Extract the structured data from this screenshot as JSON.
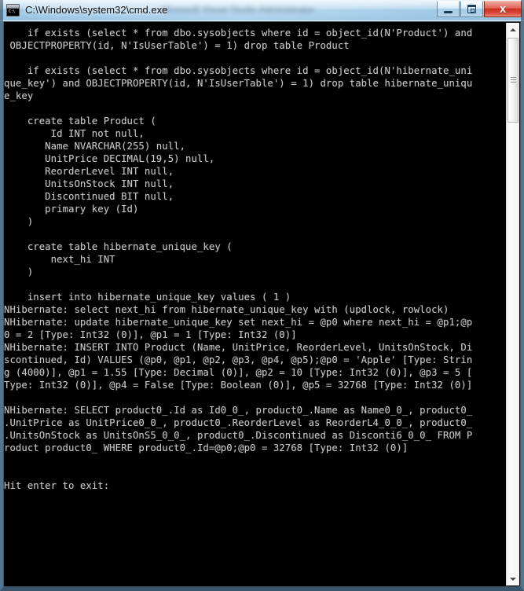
{
  "window": {
    "title": "C:\\Windows\\system32\\cmd.exe",
    "title_redacted": "Microsoft Visual Studio Administrator",
    "icon": "cmd-console-icon",
    "prompt_glyph": "C:\\",
    "buttons": {
      "minimize_label": "Minimize",
      "maximize_label": "Restore",
      "close_label": "x"
    }
  },
  "scrollbar": {
    "up_arrow_label": "Scroll up",
    "down_arrow_label": "Scroll down",
    "thumb_label": "Scroll thumb"
  },
  "console": {
    "background_color": "#000000",
    "text_color": "#c8c8c8",
    "lines": [
      "    if exists (select * from dbo.sysobjects where id = object_id(N'Product') and",
      " OBJECTPROPERTY(id, N'IsUserTable') = 1) drop table Product",
      "",
      "    if exists (select * from dbo.sysobjects where id = object_id(N'hibernate_uni",
      "que_key') and OBJECTPROPERTY(id, N'IsUserTable') = 1) drop table hibernate_uniqu",
      "e_key",
      "",
      "    create table Product (",
      "        Id INT not null,",
      "       Name NVARCHAR(255) null,",
      "       UnitPrice DECIMAL(19,5) null,",
      "       ReorderLevel INT null,",
      "       UnitsOnStock INT null,",
      "       Discontinued BIT null,",
      "       primary key (Id)",
      "    )",
      "",
      "    create table hibernate_unique_key (",
      "        next_hi INT",
      "    )",
      "",
      "    insert into hibernate_unique_key values ( 1 )",
      "NHibernate: select next_hi from hibernate_unique_key with (updlock, rowlock)",
      "NHibernate: update hibernate_unique_key set next_hi = @p0 where next_hi = @p1;@p",
      "0 = 2 [Type: Int32 (0)], @p1 = 1 [Type: Int32 (0)]",
      "NHibernate: INSERT INTO Product (Name, UnitPrice, ReorderLevel, UnitsOnStock, Di",
      "scontinued, Id) VALUES (@p0, @p1, @p2, @p3, @p4, @p5);@p0 = 'Apple' [Type: Strin",
      "g (4000)], @p1 = 1.55 [Type: Decimal (0)], @p2 = 10 [Type: Int32 (0)], @p3 = 5 [",
      "Type: Int32 (0)], @p4 = False [Type: Boolean (0)], @p5 = 32768 [Type: Int32 (0)]",
      "",
      "NHibernate: SELECT product0_.Id as Id0_0_, product0_.Name as Name0_0_, product0_",
      ".UnitPrice as UnitPrice0_0_, product0_.ReorderLevel as ReorderL4_0_0_, product0_",
      ".UnitsOnStock as UnitsOnS5_0_0_, product0_.Discontinued as Disconti6_0_0_ FROM P",
      "roduct product0_ WHERE product0_.Id=@p0;@p0 = 32768 [Type: Int32 (0)]",
      "",
      "",
      "Hit enter to exit:"
    ]
  }
}
